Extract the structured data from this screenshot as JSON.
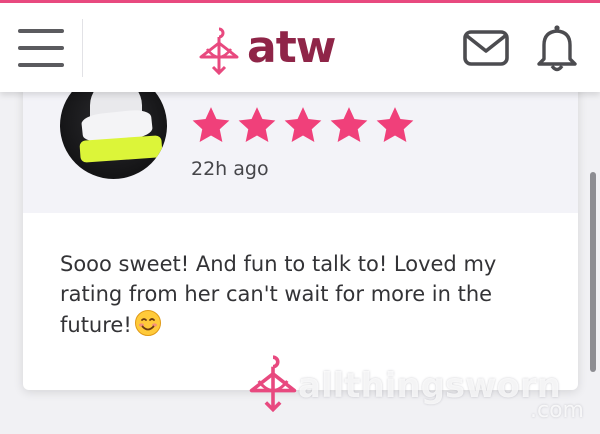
{
  "header": {
    "logo_text": "atw",
    "menu_icon": "hamburger-menu-icon",
    "mail_icon": "envelope-icon",
    "notification_icon": "bell-icon"
  },
  "review": {
    "rating": 5,
    "max_rating": 5,
    "time_ago": "22h ago",
    "text": "Sooo sweet! And fun to talk to! Loved my rating from her can't wait for more in the future!",
    "emoji": "smiling-face-icon"
  },
  "watermark": {
    "brand": "allthingsworn",
    "tld": ".com"
  },
  "colors": {
    "accent_pink": "#e8497f",
    "logo_maroon": "#8f2548",
    "star_pink": "#f0407a",
    "card_header_bg": "#f3f3f8",
    "page_bg": "#f1f1f4"
  }
}
